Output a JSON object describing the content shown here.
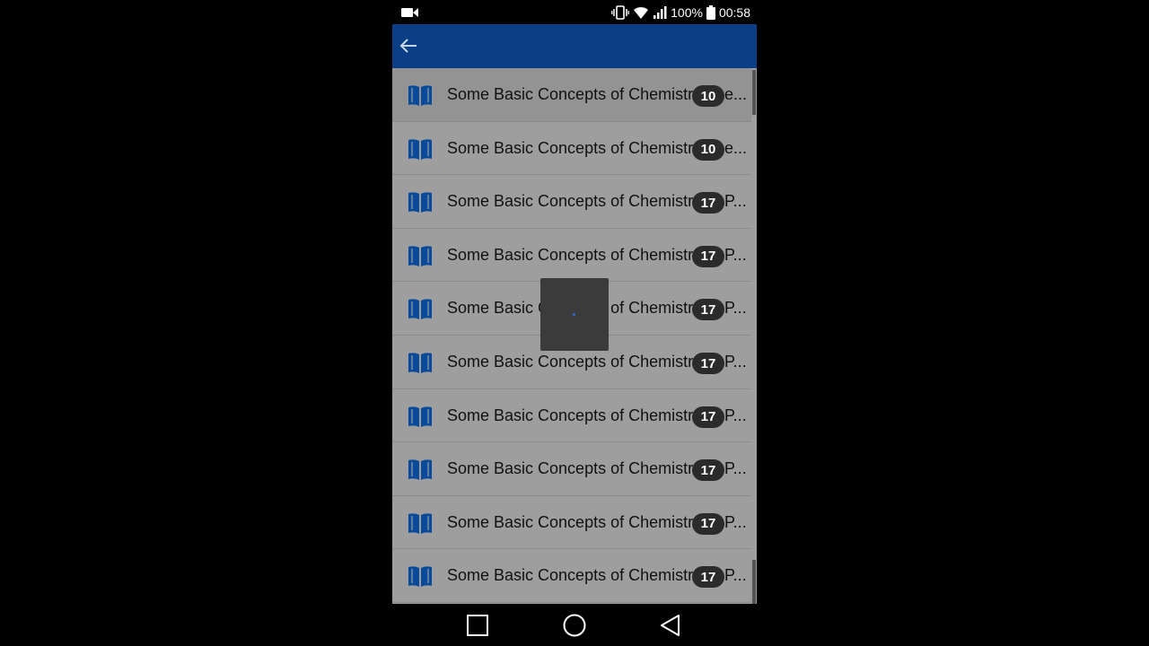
{
  "status_bar": {
    "battery_percent": "100%",
    "time": "00:58",
    "icons": [
      "video-camera-icon",
      "vibrate-icon",
      "wifi-icon",
      "signal-icon",
      "battery-icon"
    ]
  },
  "app_bar": {
    "color": "#0a3f85",
    "back_icon": "arrow-left-icon"
  },
  "list": {
    "items": [
      {
        "title": "Some Basic Concepts of Chemistr",
        "count": "10",
        "tail": "e..."
      },
      {
        "title": "Some Basic Concepts of Chemistr",
        "count": "10",
        "tail": "e..."
      },
      {
        "title": "Some Basic Concepts of Chemistr",
        "count": "17",
        "tail": "P..."
      },
      {
        "title": "Some Basic Concepts of Chemistr",
        "count": "17",
        "tail": "P..."
      },
      {
        "title": "Some Basic Concepts of Chemistr",
        "count": "17",
        "tail": "P..."
      },
      {
        "title": "Some Basic Concepts of Chemistr",
        "count": "17",
        "tail": "P..."
      },
      {
        "title": "Some Basic Concepts of Chemistr",
        "count": "17",
        "tail": "P..."
      },
      {
        "title": "Some Basic Concepts of Chemistr",
        "count": "17",
        "tail": "P..."
      },
      {
        "title": "Some Basic Concepts of Chemistr",
        "count": "17",
        "tail": "P..."
      },
      {
        "title": "Some Basic Concepts of Chemistr",
        "count": "17",
        "tail": "P..."
      }
    ],
    "item_icon": "book-icon",
    "icon_color": "#0a4a9a"
  },
  "overlay": {
    "type": "loading-dialog"
  },
  "nav_bar": {
    "buttons": [
      "recent-apps-icon",
      "home-icon",
      "back-icon"
    ]
  }
}
